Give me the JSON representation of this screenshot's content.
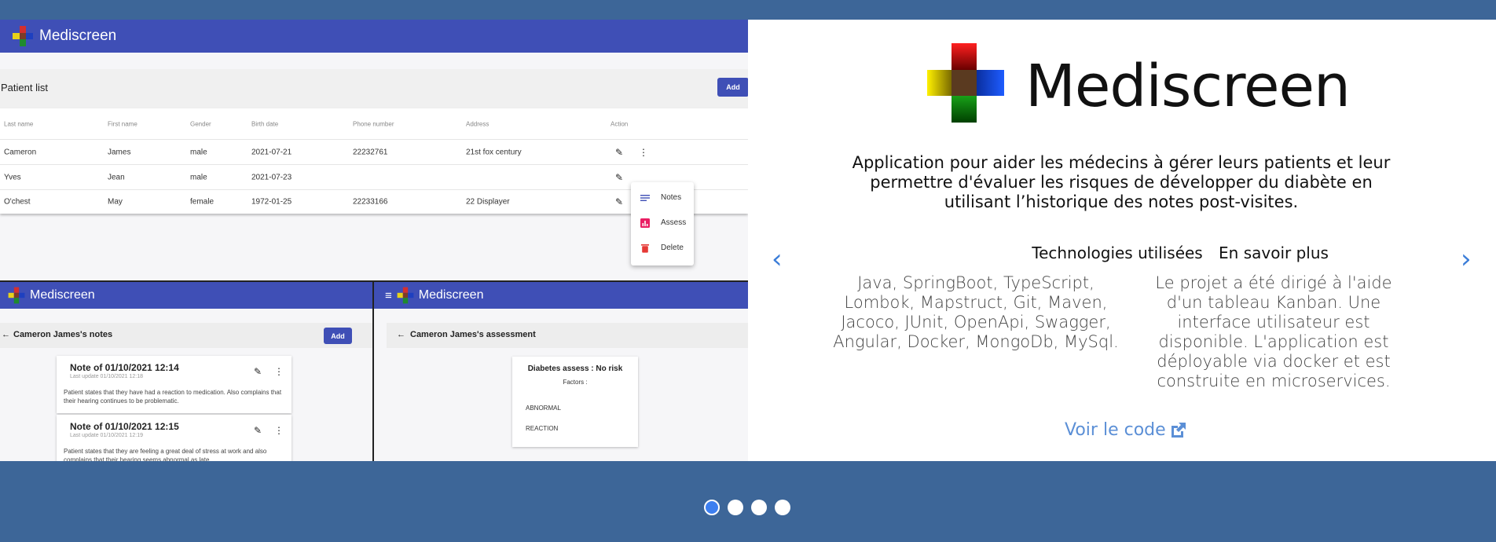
{
  "screenshot": {
    "brand": "Mediscreen",
    "patient_list": {
      "title": "Patient list",
      "add_label": "Add",
      "columns": [
        "Last name",
        "First name",
        "Gender",
        "Birth date",
        "Phone number",
        "Address",
        "Action"
      ],
      "rows": [
        [
          "Cameron",
          "James",
          "male",
          "2021-07-21",
          "22232761",
          "21st fox century"
        ],
        [
          "Yves",
          "Jean",
          "male",
          "2021-07-23",
          "",
          ""
        ],
        [
          "O'chest",
          "May",
          "female",
          "1972-01-25",
          "22233166",
          "22 Displayer"
        ]
      ],
      "menu": [
        {
          "label": "Notes",
          "icon": "notes-icon",
          "color": "#3f4fb6"
        },
        {
          "label": "Assess",
          "icon": "chart-icon",
          "color": "#e91e63"
        },
        {
          "label": "Delete",
          "icon": "trash-icon",
          "color": "#e53935"
        }
      ]
    },
    "notes": {
      "title": "Cameron James's notes",
      "add_label": "Add",
      "items": [
        {
          "title": "Note of 01/10/2021 12:14",
          "update": "Last update 01/10/2021 12:18",
          "body": "Patient states that they have had a reaction to medication. Also complains that their hearing continues to be problematic."
        },
        {
          "title": "Note of 01/10/2021 12:15",
          "update": "Last update 01/10/2021 12:19",
          "body": "Patient states that they are feeling a great deal of stress at work and also complains that their hearing seems abnormal as late"
        }
      ]
    },
    "assessment": {
      "title": "Cameron James's assessment",
      "result": "Diabetes assess : No risk",
      "factors_label": "Factors :",
      "factors": [
        "ABNORMAL",
        "REACTION"
      ]
    }
  },
  "info": {
    "brand": "Mediscreen",
    "description": "Application pour aider les médecins à gérer leurs patients et leur permettre d'évaluer les risques de développer du diabète en utilisant l’historique des notes post-visites.",
    "tech_title": "Technologies utilisées",
    "tech_text": "Java, SpringBoot, TypeScript, Lombok, Mapstruct, Git, Maven, Jacoco, JUnit, OpenApi, Swagger, Angular, Docker, MongoDb, MySql.",
    "more_title": "En savoir plus",
    "more_text": "Le projet a été dirigé à l'aide d'un tableau Kanban. Une interface utilisateur est disponible. L'application est déployable via docker et est construite en microservices.",
    "code_link": "Voir le code",
    "prev_icon": "chevron-left-icon",
    "next_icon": "chevron-right-icon"
  },
  "carousel": {
    "dot_count": 4,
    "active_index": 0,
    "active_color": "#3d7ff0"
  },
  "colors": {
    "background": "#3d6698",
    "appbar": "#3f4fb6",
    "link": "#5b8fd6",
    "arrow": "#3b7dd8"
  }
}
